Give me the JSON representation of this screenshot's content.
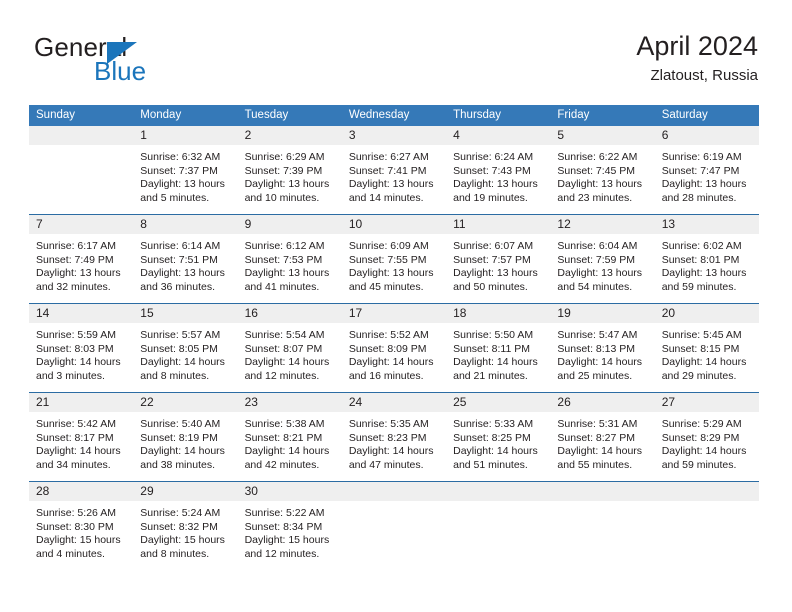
{
  "brand": {
    "name_part1": "General",
    "name_part2": "Blue",
    "logo_icon": "triangle-logo-icon",
    "accent_color": "#1b75bb"
  },
  "header": {
    "month_title": "April 2024",
    "location": "Zlatoust, Russia"
  },
  "theme": {
    "header_row_color": "#3579b8",
    "daynum_band_color": "#efefef",
    "row_separator_color": "#2b6ca3",
    "text_color": "#231f20"
  },
  "calendar": {
    "weekday_headers": [
      "Sunday",
      "Monday",
      "Tuesday",
      "Wednesday",
      "Thursday",
      "Friday",
      "Saturday"
    ],
    "weeks": [
      [
        {
          "day": "",
          "blank": true,
          "sunrise": "",
          "sunset": "",
          "daylight1": "",
          "daylight2": ""
        },
        {
          "day": "1",
          "sunrise": "Sunrise: 6:32 AM",
          "sunset": "Sunset: 7:37 PM",
          "daylight1": "Daylight: 13 hours",
          "daylight2": "and 5 minutes."
        },
        {
          "day": "2",
          "sunrise": "Sunrise: 6:29 AM",
          "sunset": "Sunset: 7:39 PM",
          "daylight1": "Daylight: 13 hours",
          "daylight2": "and 10 minutes."
        },
        {
          "day": "3",
          "sunrise": "Sunrise: 6:27 AM",
          "sunset": "Sunset: 7:41 PM",
          "daylight1": "Daylight: 13 hours",
          "daylight2": "and 14 minutes."
        },
        {
          "day": "4",
          "sunrise": "Sunrise: 6:24 AM",
          "sunset": "Sunset: 7:43 PM",
          "daylight1": "Daylight: 13 hours",
          "daylight2": "and 19 minutes."
        },
        {
          "day": "5",
          "sunrise": "Sunrise: 6:22 AM",
          "sunset": "Sunset: 7:45 PM",
          "daylight1": "Daylight: 13 hours",
          "daylight2": "and 23 minutes."
        },
        {
          "day": "6",
          "sunrise": "Sunrise: 6:19 AM",
          "sunset": "Sunset: 7:47 PM",
          "daylight1": "Daylight: 13 hours",
          "daylight2": "and 28 minutes."
        }
      ],
      [
        {
          "day": "7",
          "sunrise": "Sunrise: 6:17 AM",
          "sunset": "Sunset: 7:49 PM",
          "daylight1": "Daylight: 13 hours",
          "daylight2": "and 32 minutes."
        },
        {
          "day": "8",
          "sunrise": "Sunrise: 6:14 AM",
          "sunset": "Sunset: 7:51 PM",
          "daylight1": "Daylight: 13 hours",
          "daylight2": "and 36 minutes."
        },
        {
          "day": "9",
          "sunrise": "Sunrise: 6:12 AM",
          "sunset": "Sunset: 7:53 PM",
          "daylight1": "Daylight: 13 hours",
          "daylight2": "and 41 minutes."
        },
        {
          "day": "10",
          "sunrise": "Sunrise: 6:09 AM",
          "sunset": "Sunset: 7:55 PM",
          "daylight1": "Daylight: 13 hours",
          "daylight2": "and 45 minutes."
        },
        {
          "day": "11",
          "sunrise": "Sunrise: 6:07 AM",
          "sunset": "Sunset: 7:57 PM",
          "daylight1": "Daylight: 13 hours",
          "daylight2": "and 50 minutes."
        },
        {
          "day": "12",
          "sunrise": "Sunrise: 6:04 AM",
          "sunset": "Sunset: 7:59 PM",
          "daylight1": "Daylight: 13 hours",
          "daylight2": "and 54 minutes."
        },
        {
          "day": "13",
          "sunrise": "Sunrise: 6:02 AM",
          "sunset": "Sunset: 8:01 PM",
          "daylight1": "Daylight: 13 hours",
          "daylight2": "and 59 minutes."
        }
      ],
      [
        {
          "day": "14",
          "sunrise": "Sunrise: 5:59 AM",
          "sunset": "Sunset: 8:03 PM",
          "daylight1": "Daylight: 14 hours",
          "daylight2": "and 3 minutes."
        },
        {
          "day": "15",
          "sunrise": "Sunrise: 5:57 AM",
          "sunset": "Sunset: 8:05 PM",
          "daylight1": "Daylight: 14 hours",
          "daylight2": "and 8 minutes."
        },
        {
          "day": "16",
          "sunrise": "Sunrise: 5:54 AM",
          "sunset": "Sunset: 8:07 PM",
          "daylight1": "Daylight: 14 hours",
          "daylight2": "and 12 minutes."
        },
        {
          "day": "17",
          "sunrise": "Sunrise: 5:52 AM",
          "sunset": "Sunset: 8:09 PM",
          "daylight1": "Daylight: 14 hours",
          "daylight2": "and 16 minutes."
        },
        {
          "day": "18",
          "sunrise": "Sunrise: 5:50 AM",
          "sunset": "Sunset: 8:11 PM",
          "daylight1": "Daylight: 14 hours",
          "daylight2": "and 21 minutes."
        },
        {
          "day": "19",
          "sunrise": "Sunrise: 5:47 AM",
          "sunset": "Sunset: 8:13 PM",
          "daylight1": "Daylight: 14 hours",
          "daylight2": "and 25 minutes."
        },
        {
          "day": "20",
          "sunrise": "Sunrise: 5:45 AM",
          "sunset": "Sunset: 8:15 PM",
          "daylight1": "Daylight: 14 hours",
          "daylight2": "and 29 minutes."
        }
      ],
      [
        {
          "day": "21",
          "sunrise": "Sunrise: 5:42 AM",
          "sunset": "Sunset: 8:17 PM",
          "daylight1": "Daylight: 14 hours",
          "daylight2": "and 34 minutes."
        },
        {
          "day": "22",
          "sunrise": "Sunrise: 5:40 AM",
          "sunset": "Sunset: 8:19 PM",
          "daylight1": "Daylight: 14 hours",
          "daylight2": "and 38 minutes."
        },
        {
          "day": "23",
          "sunrise": "Sunrise: 5:38 AM",
          "sunset": "Sunset: 8:21 PM",
          "daylight1": "Daylight: 14 hours",
          "daylight2": "and 42 minutes."
        },
        {
          "day": "24",
          "sunrise": "Sunrise: 5:35 AM",
          "sunset": "Sunset: 8:23 PM",
          "daylight1": "Daylight: 14 hours",
          "daylight2": "and 47 minutes."
        },
        {
          "day": "25",
          "sunrise": "Sunrise: 5:33 AM",
          "sunset": "Sunset: 8:25 PM",
          "daylight1": "Daylight: 14 hours",
          "daylight2": "and 51 minutes."
        },
        {
          "day": "26",
          "sunrise": "Sunrise: 5:31 AM",
          "sunset": "Sunset: 8:27 PM",
          "daylight1": "Daylight: 14 hours",
          "daylight2": "and 55 minutes."
        },
        {
          "day": "27",
          "sunrise": "Sunrise: 5:29 AM",
          "sunset": "Sunset: 8:29 PM",
          "daylight1": "Daylight: 14 hours",
          "daylight2": "and 59 minutes."
        }
      ],
      [
        {
          "day": "28",
          "sunrise": "Sunrise: 5:26 AM",
          "sunset": "Sunset: 8:30 PM",
          "daylight1": "Daylight: 15 hours",
          "daylight2": "and 4 minutes."
        },
        {
          "day": "29",
          "sunrise": "Sunrise: 5:24 AM",
          "sunset": "Sunset: 8:32 PM",
          "daylight1": "Daylight: 15 hours",
          "daylight2": "and 8 minutes."
        },
        {
          "day": "30",
          "sunrise": "Sunrise: 5:22 AM",
          "sunset": "Sunset: 8:34 PM",
          "daylight1": "Daylight: 15 hours",
          "daylight2": "and 12 minutes."
        },
        {
          "day": "",
          "blank": true,
          "sunrise": "",
          "sunset": "",
          "daylight1": "",
          "daylight2": ""
        },
        {
          "day": "",
          "blank": true,
          "sunrise": "",
          "sunset": "",
          "daylight1": "",
          "daylight2": ""
        },
        {
          "day": "",
          "blank": true,
          "sunrise": "",
          "sunset": "",
          "daylight1": "",
          "daylight2": ""
        },
        {
          "day": "",
          "blank": true,
          "sunrise": "",
          "sunset": "",
          "daylight1": "",
          "daylight2": ""
        }
      ]
    ]
  }
}
